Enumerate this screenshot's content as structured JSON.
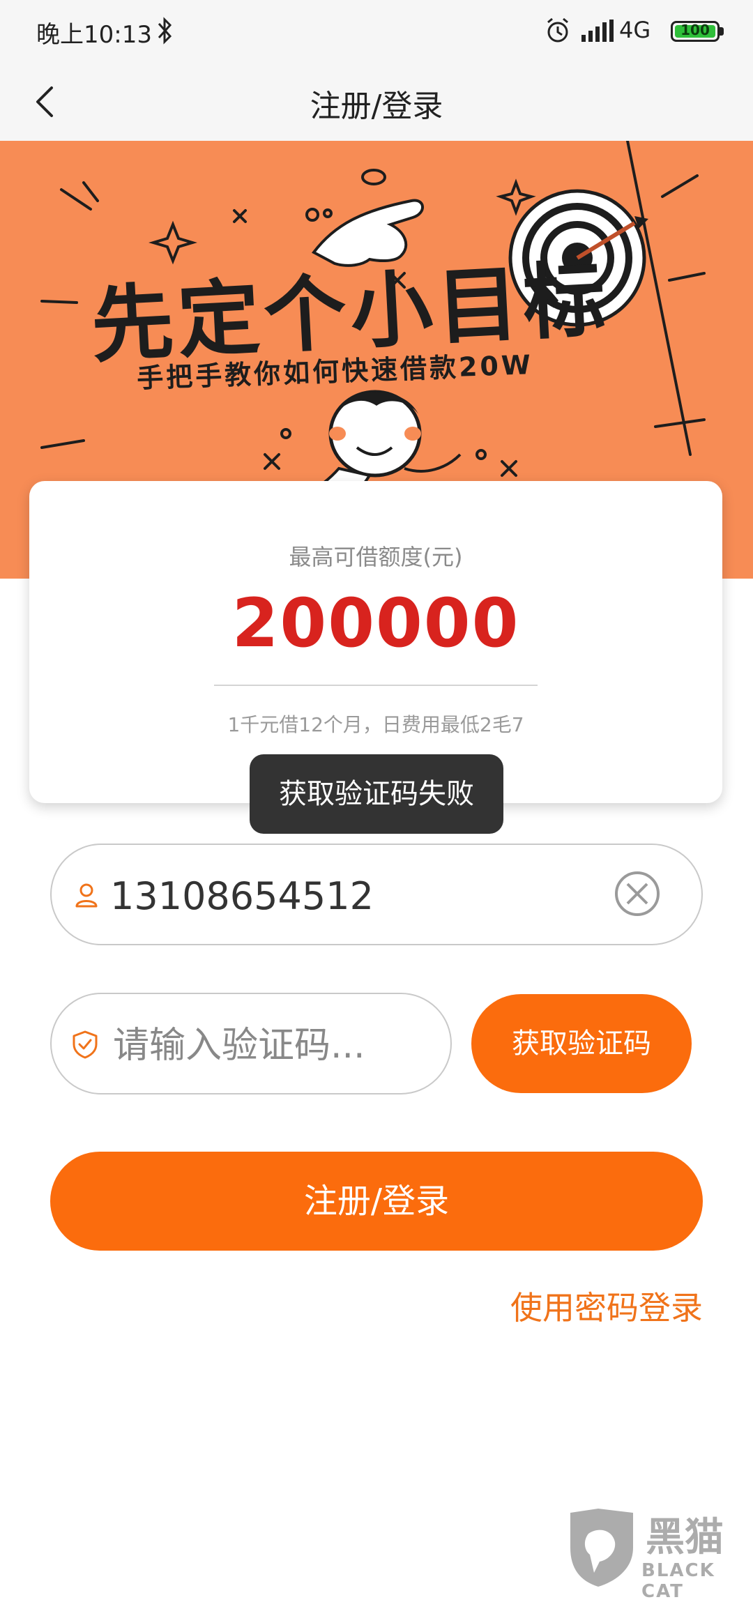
{
  "status_bar": {
    "time": "晚上10:13",
    "network": "4G",
    "battery": "100",
    "icons": [
      "bluetooth-icon",
      "alarm-icon",
      "signal-icon",
      "battery-icon"
    ]
  },
  "nav": {
    "title": "注册/登录",
    "back_icon": "chevron-left-icon"
  },
  "banner": {
    "headline": "先定个小目标",
    "subtitle": "手把手教你如何快速借款20W",
    "background_color": "#f78c55"
  },
  "card": {
    "label": "最高可借额度(元)",
    "amount": "200000",
    "note": "1千元借12个月，日费用最低2毛7",
    "amount_color": "#d8231e"
  },
  "toast": {
    "message": "获取验证码失败"
  },
  "form": {
    "phone_value": "13108654512",
    "code_placeholder": "请输入验证码...",
    "get_code_label": "获取验证码",
    "submit_label": "注册/登录",
    "password_login_label": "使用密码登录",
    "accent_color": "#fb6c0d"
  },
  "watermark": {
    "text": "黑猫",
    "sub": "BLACK CAT"
  }
}
